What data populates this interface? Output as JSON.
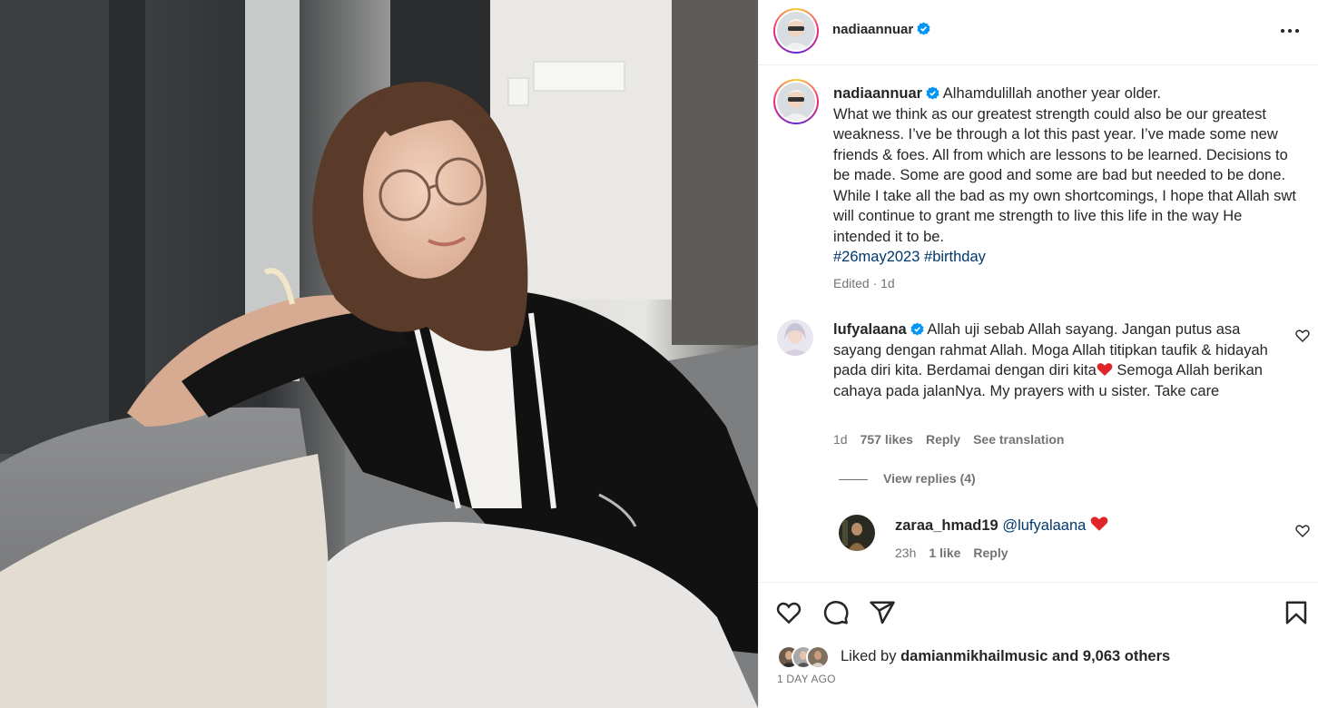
{
  "post": {
    "author": "nadiaannuar",
    "caption_text": "Alhamdulillah another year older.\nWhat we think as our greatest strength could also be our greatest weakness. I’ve be through a lot this past year. I’ve made some new friends & foes. All from which are lessons to be learned. Decisions to be made. Some are good and some are bad but needed to be done. While I take all the bad as my own shortcomings, I hope that Allah swt will continue to grant me strength to live this life in the way He intended it to be.",
    "hashtags": [
      "#26may2023",
      "#birthday"
    ],
    "caption_meta": "Edited · 1d",
    "liked_by_prefix": "Liked by",
    "liked_by_user": "damianmikhailmusic",
    "liked_by_suffix": "and 9,063 others",
    "time_ago": "1 DAY AGO"
  },
  "comments": [
    {
      "user": "lufyalaana",
      "verified": true,
      "text_before_emoji": "Allah uji sebab Allah sayang. Jangan putus asa sayang dengan rahmat Allah. Moga Allah titipkan taufik & hidayah pada diri kita. Berdamai dengan diri kita",
      "text_after_emoji": " Semoga Allah berikan cahaya pada jalanNya. My prayers with u sister. Take care",
      "age": "1d",
      "likes": "757 likes",
      "reply_label": "Reply",
      "translate_label": "See translation",
      "view_replies": "View replies (4)"
    },
    {
      "user": "zaraa_hmad19",
      "mention": "@lufyalaana",
      "age": "23h",
      "likes": "1 like",
      "reply_label": "Reply"
    }
  ],
  "icons": {
    "more": "more-icon",
    "like": "heart-icon",
    "comment": "comment-icon",
    "share": "share-icon",
    "save": "bookmark-icon",
    "verified": "verified-badge-icon"
  },
  "colors": {
    "verified": "#0095f6",
    "hashtag": "#00376b",
    "emoji_heart": "#e0242a",
    "muted": "#737373"
  }
}
